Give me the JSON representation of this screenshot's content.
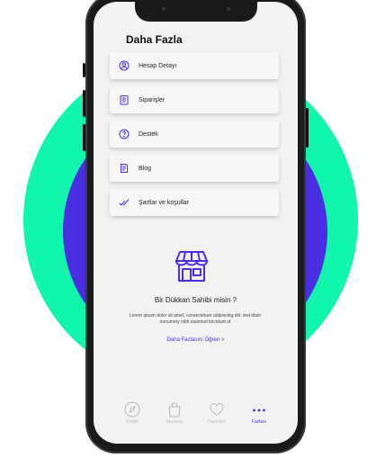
{
  "header": {
    "title": "Daha Fazla"
  },
  "menu": [
    {
      "label": "Hesap Detayı",
      "icon": "user-circle-icon"
    },
    {
      "label": "Siparişler",
      "icon": "clipboard-list-icon"
    },
    {
      "label": "Destek",
      "icon": "help-circle-icon"
    },
    {
      "label": "Blog",
      "icon": "document-icon"
    },
    {
      "label": "Şartlar ve koşullar",
      "icon": "double-check-icon"
    }
  ],
  "promo": {
    "icon": "storefront-icon",
    "title": "Bir Dükkan Sahibi misin ?",
    "text": "Lorem ipsum dolor sit amet, consectetuer adipiscing elit, sed diam nonummy nibh euismod tincidunt ut",
    "link": "Daha Fazlasını Öğren  >"
  },
  "tabs": [
    {
      "label": "Keşfet",
      "icon": "compass-icon",
      "active": false
    },
    {
      "label": "Alışveriş",
      "icon": "shopping-bag-icon",
      "active": false
    },
    {
      "label": "Favoriler",
      "icon": "heart-icon",
      "active": false
    },
    {
      "label": "Fazlası",
      "icon": "more-dots-icon",
      "active": true
    }
  ],
  "colors": {
    "accent": "#4a2de0",
    "green": "#12f5ad",
    "screen": "#f2f2f2"
  }
}
